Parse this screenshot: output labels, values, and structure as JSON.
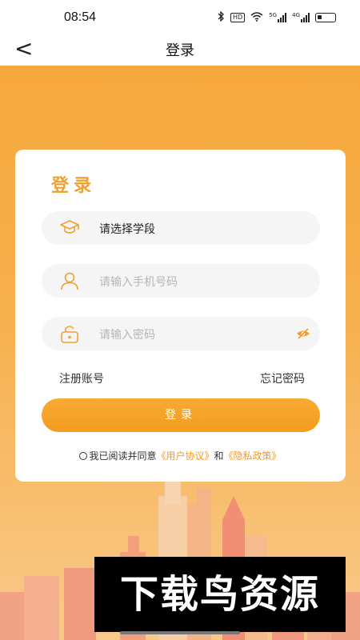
{
  "status_bar": {
    "time": "08:54",
    "icons": [
      "bluetooth-icon",
      "hd-icon",
      "wifi-icon",
      "5g-signal-icon",
      "4g-signal-icon",
      "battery-icon"
    ],
    "hd_label": "HD",
    "net1": "5G",
    "net2": "4G"
  },
  "nav": {
    "back_symbol": "<",
    "title": "登录"
  },
  "card": {
    "title": "登录",
    "stage_field": {
      "value": "请选择学段"
    },
    "phone_field": {
      "placeholder": "请输入手机号码"
    },
    "password_field": {
      "placeholder": "请输入密码"
    },
    "register_link": "注册账号",
    "forgot_link": "忘记密码",
    "login_button": "登录",
    "agreement": {
      "prefix": "我已阅读并同意",
      "user_agreement": "《用户协议》",
      "and": "和",
      "privacy_policy": "《隐私政策》"
    }
  },
  "watermark": "下载鸟资源",
  "colors": {
    "accent": "#f49c1e",
    "link": "#f09a2a",
    "background_top": "#f6a83c"
  }
}
